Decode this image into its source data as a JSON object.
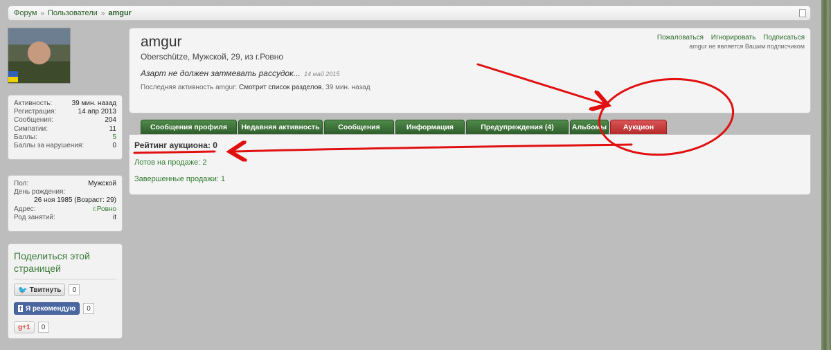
{
  "breadcrumb": {
    "items": [
      "Форум",
      "Пользователи"
    ],
    "separator": "»",
    "current": "amgur"
  },
  "stats": [
    {
      "label": "Активность:",
      "value": "39 мин. назад"
    },
    {
      "label": "Регистрация:",
      "value": "14 апр 2013"
    },
    {
      "label": "Сообщения:",
      "value": "204"
    },
    {
      "label": "Симпатии:",
      "value": "11"
    },
    {
      "label": "Баллы:",
      "value": "5"
    },
    {
      "label": "Баллы за нарушения:",
      "value": "0"
    }
  ],
  "personal": {
    "gender_label": "Пол:",
    "gender": "Мужской",
    "birthday_label": "День рождения:",
    "birthday": "26 ноя 1985 (Возраст: 29)",
    "address_label": "Адрес:",
    "address": "г.Ровно",
    "occupation_label": "Род занятий:",
    "occupation": "it"
  },
  "share": {
    "title": "Поделиться этой страницей",
    "tweet_label": "Твитнуть",
    "tweet_count": "0",
    "fb_label": "Я рекомендую",
    "fb_count": "0",
    "gplus_label": "+1",
    "gplus_count": "0"
  },
  "profile": {
    "username": "amgur",
    "info": "Oberschütze, Мужской, 29, из ",
    "city": "г.Ровно",
    "status": "Азарт не должен затмевать рассудок...",
    "status_date": "14 май 2015",
    "last_activity_label": "Последняя активность amgur:",
    "last_activity_what": "Смотрит список разделов",
    "last_activity_time": ", 39 мин. назад",
    "action_report": "Пожаловаться",
    "action_ignore": "Игнорировать",
    "action_follow": "Подписаться",
    "follow_note": "amgur не является Вашим подписчиком"
  },
  "tabs": [
    {
      "label": "Сообщения профиля",
      "active": false
    },
    {
      "label": "Недавняя активность",
      "active": false
    },
    {
      "label": "Сообщения",
      "active": false
    },
    {
      "label": "Информация",
      "active": false
    },
    {
      "label": "Предупреждения (4)",
      "active": false
    },
    {
      "label": "Альбомы",
      "active": false
    },
    {
      "label": "Аукцион",
      "active": true
    }
  ],
  "auction": {
    "rating": "Рейтинг аукциона: 0",
    "lots": "Лотов на продаже: 2",
    "completed": "Завершенные продажи: 1"
  },
  "colors": {
    "accent_green": "#2e6b2e",
    "tab_green": "#2f5d2b",
    "tab_active_red": "#b52b2b",
    "annotation_red": "#e01010"
  }
}
